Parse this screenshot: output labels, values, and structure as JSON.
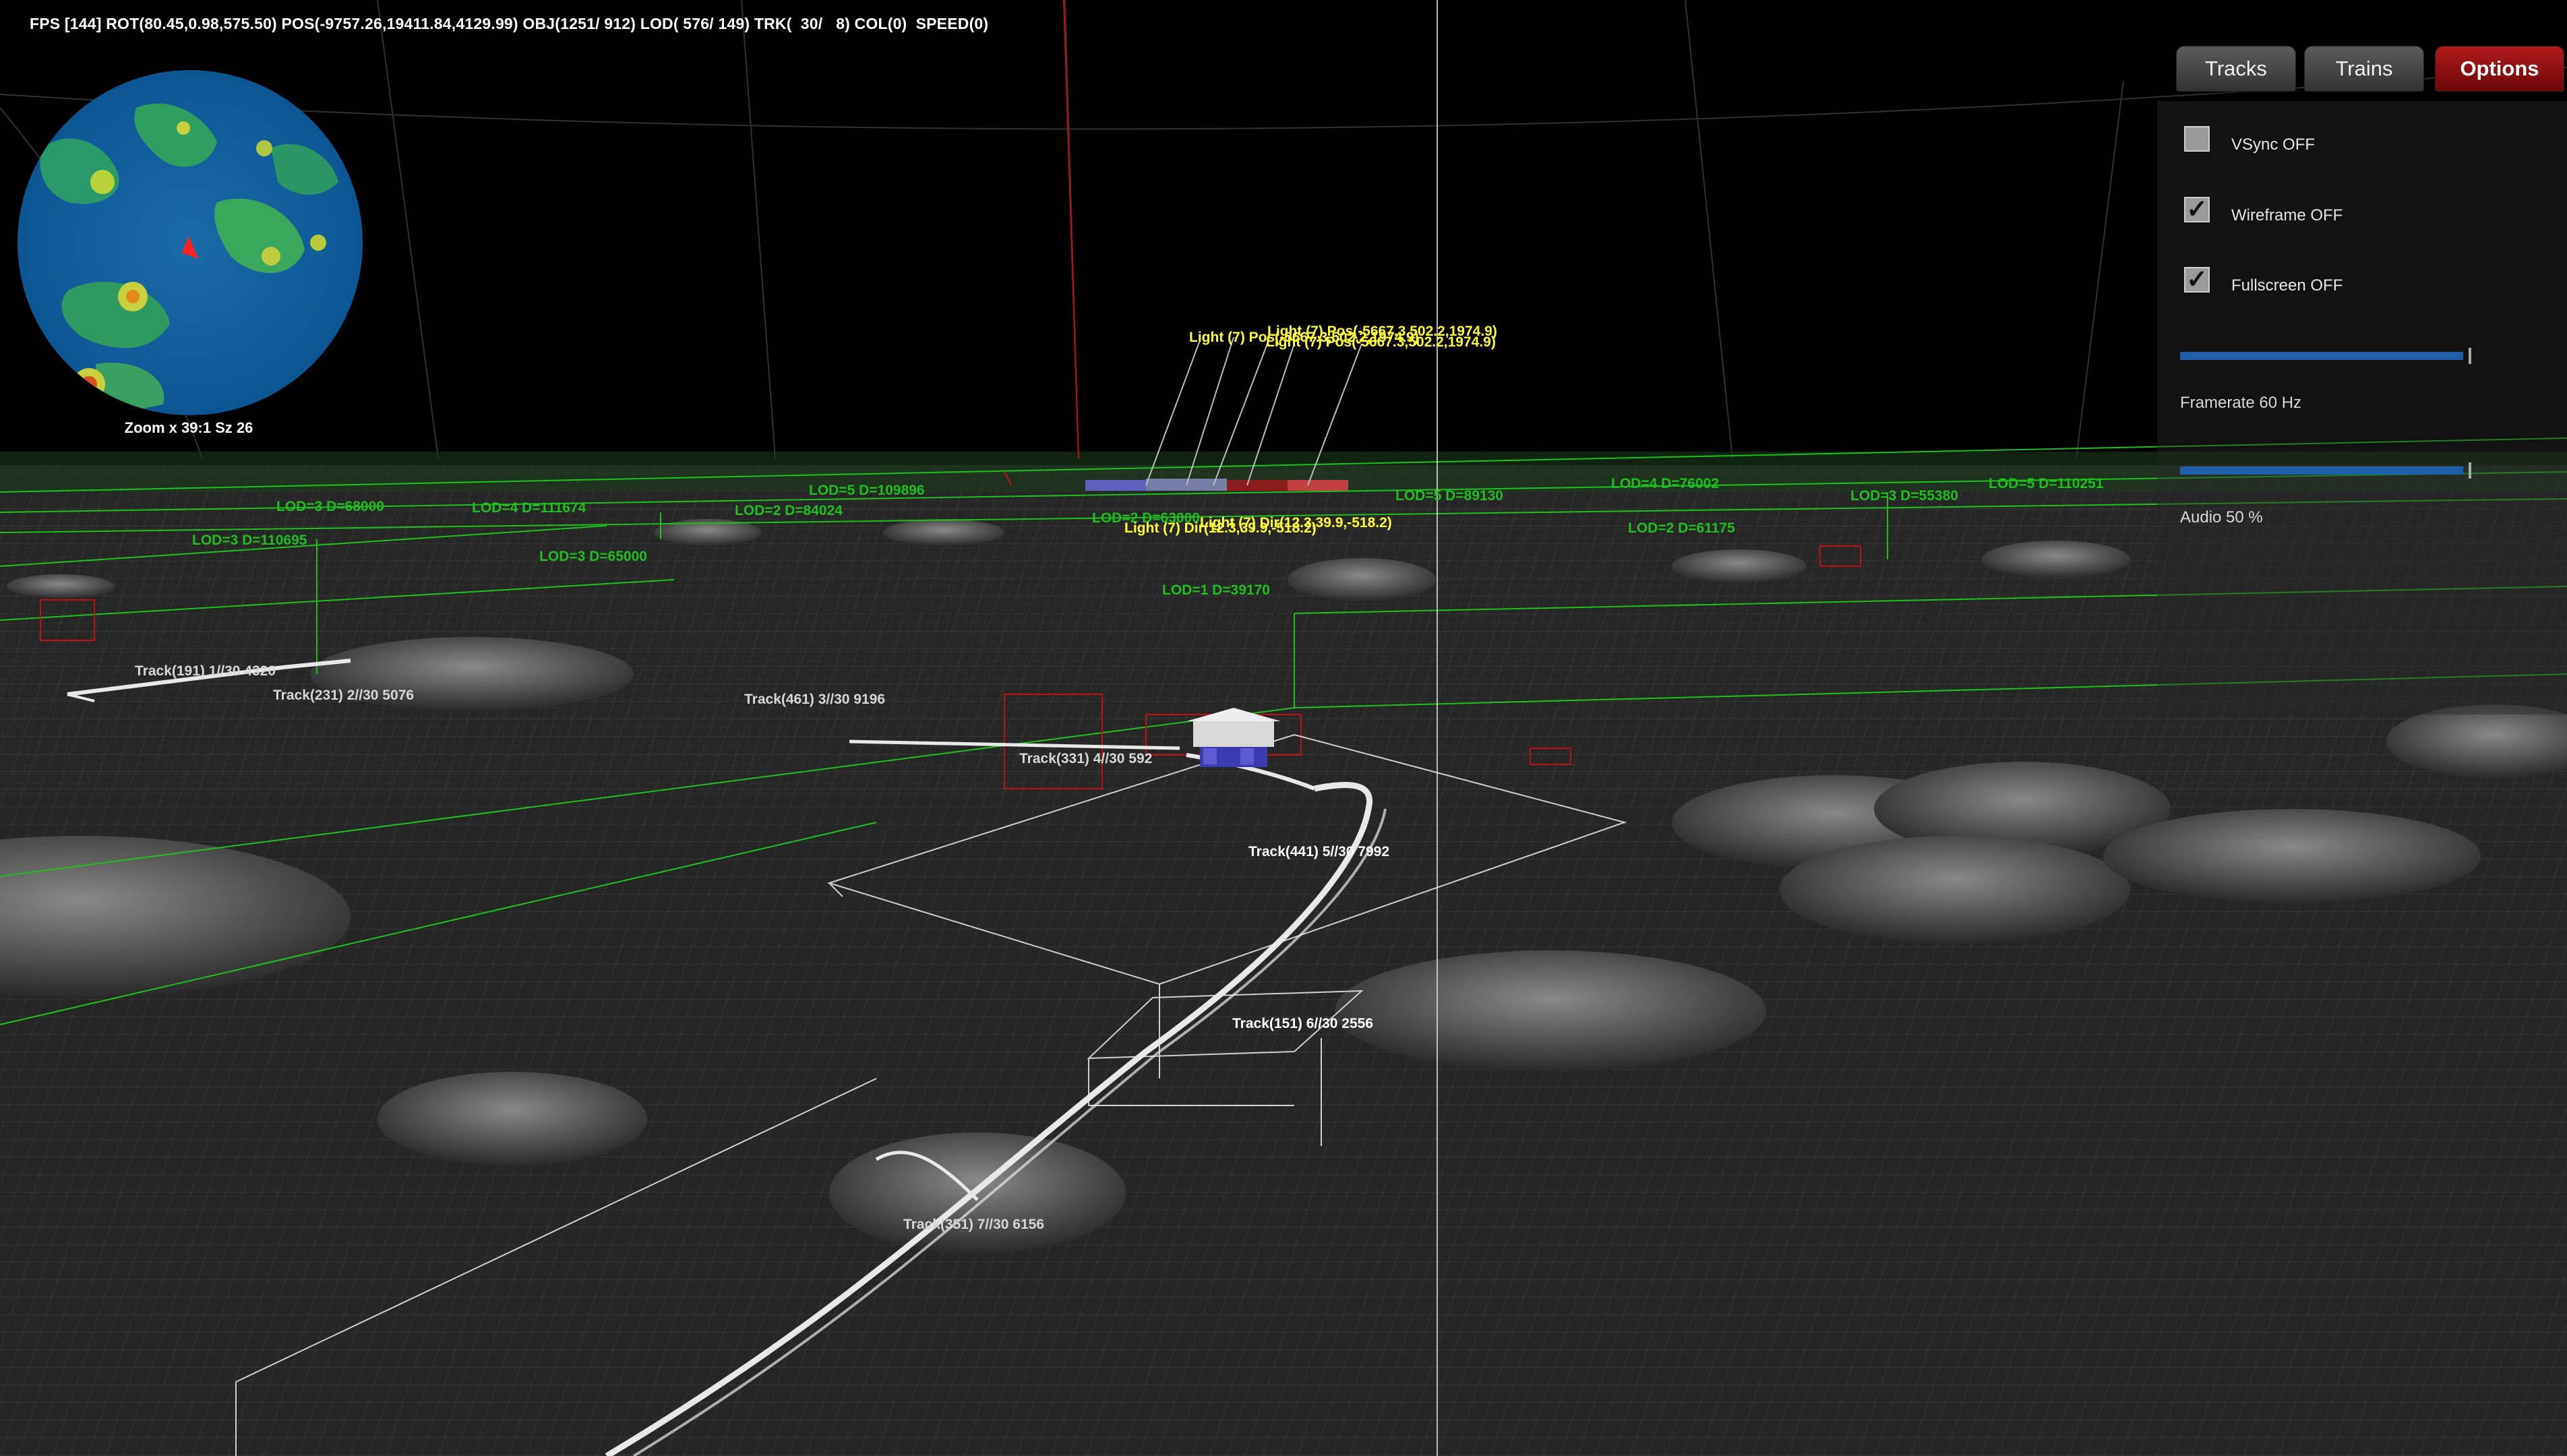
{
  "hud": {
    "stats": "FPS [144] ROT(80.45,0.98,575.50) POS(-9757.26,19411.84,4129.99) OBJ(1251/ 912) LOD( 576/ 149) TRK(  30/   8) COL(0)  SPEED(0)"
  },
  "minimap": {
    "zoom_label": "Zoom x 39:1 Sz 26"
  },
  "tabs": {
    "tracks": "Tracks",
    "trains": "Trains",
    "options": "Options",
    "active": "Options"
  },
  "options": {
    "vsync": {
      "label": "VSync OFF",
      "checked": false
    },
    "wireframe": {
      "label": "Wireframe OFF",
      "checked": true
    },
    "fullscreen": {
      "label": "Fullscreen OFF",
      "checked": true
    },
    "framerate": {
      "label": "Framerate 60 Hz"
    },
    "audio": {
      "label": "Audio 50 %",
      "value_percent": 50
    }
  },
  "scene": {
    "track_labels": [
      "Track(191) 1//30 4320",
      "Track(231) 2//30 5076",
      "Track(461) 3//30 9196",
      "Track(331) 4//30 592",
      "Track(441) 5//30 7992",
      "Track(151) 6//30 2556",
      "Track(351) 7//30 6156"
    ],
    "lod_labels": [
      "LOD=1 D=39170",
      "LOD=2 D=61175",
      "LOD=3 D=65000",
      "LOD=4 D=76002",
      "LOD=3 D=55380",
      "LOD=5 D=110251",
      "LOD=5 D=89130",
      "LOD=2 D=63000",
      "LOD=4 D=111674",
      "LOD=3 D=110695",
      "LOD=5 D=109896",
      "LOD=3 D=68000",
      "LOD=2 D=84024"
    ],
    "light_labels": [
      "Light (7) Pos(-5667.3,502.2,1974.9)",
      "Light (7) Pos(-5667.3,502.2,1974.9)",
      "Light (7) Pos(-5667.3,502.2,1974.9)",
      "Light (7) Dir(12.3,39.9,-518.2)",
      "Light (7) Dir(12.3,39.9,-518.2)"
    ],
    "colors": {
      "terrain_wire": "#8c8c8c",
      "lod_green": "#1fbf1f",
      "light_yellow": "#ffff33",
      "bbox_red": "#c01010",
      "slider_blue": "#1d5fa8",
      "options_tab_red": "#a01212"
    }
  }
}
